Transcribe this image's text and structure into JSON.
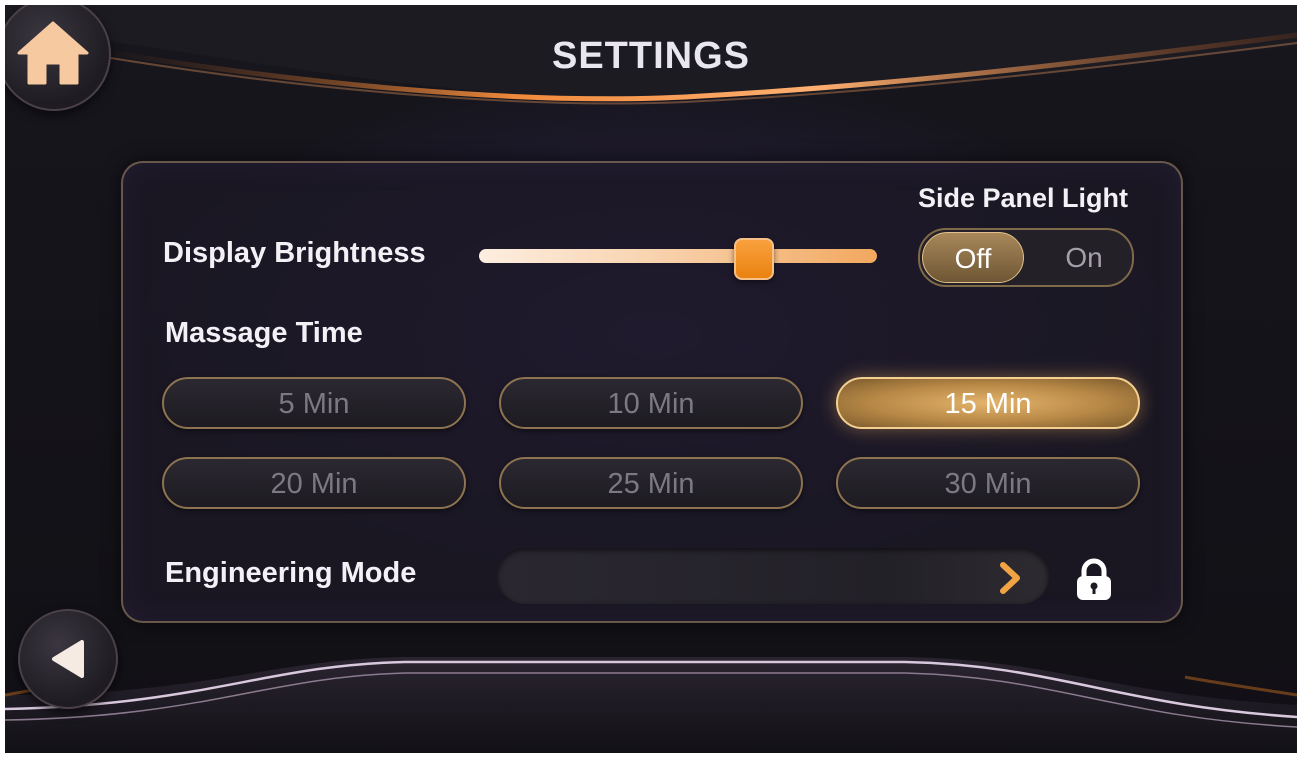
{
  "header": {
    "title": "SETTINGS"
  },
  "settings": {
    "display_brightness": {
      "label": "Display Brightness",
      "value_percent": 68
    },
    "side_panel_light": {
      "label": "Side Panel Light",
      "off_label": "Off",
      "on_label": "On",
      "selected": "Off"
    },
    "massage_time": {
      "label": "Massage Time",
      "options": [
        "5 Min",
        "10 Min",
        "15 Min",
        "20 Min",
        "25 Min",
        "30 Min"
      ],
      "selected": "15 Min"
    },
    "engineering_mode": {
      "label": "Engineering Mode",
      "locked": true
    }
  },
  "icons": {
    "home": "home-icon",
    "back": "triangle-left-icon",
    "chevron": "chevron-right-icon",
    "lock": "lock-icon"
  },
  "colors": {
    "accent": "#f29a2e",
    "gold": "#d9a65c",
    "background": "#141318",
    "text": "#f3f1f6"
  }
}
